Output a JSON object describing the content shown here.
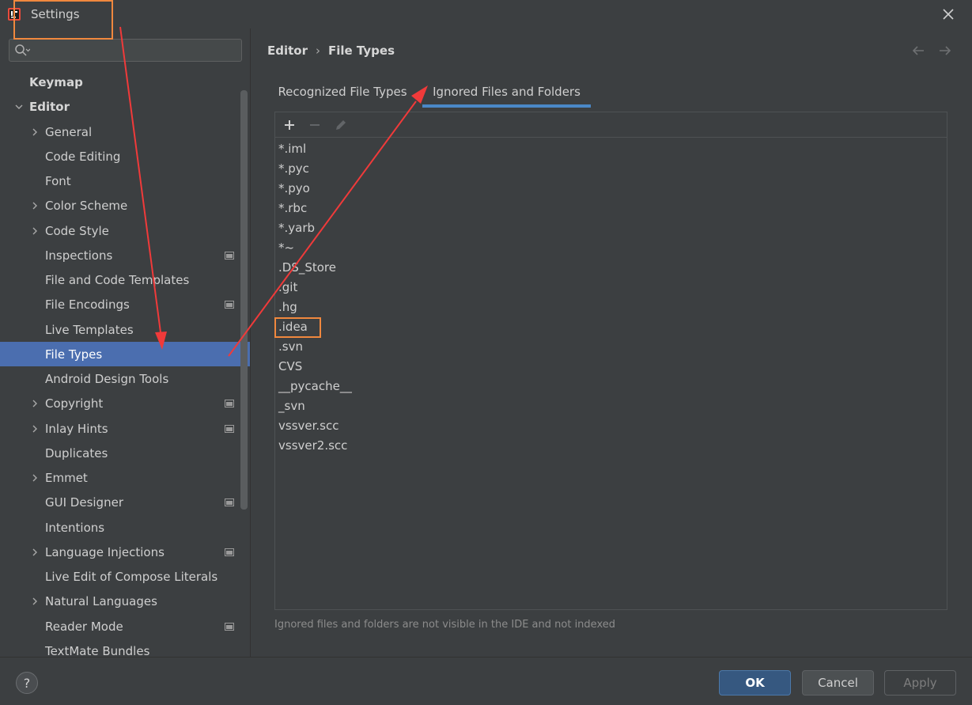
{
  "window": {
    "title": "Settings"
  },
  "search": {
    "placeholder": "",
    "value": ""
  },
  "sidebar": {
    "items": [
      {
        "label": "Keymap"
      },
      {
        "label": "Editor"
      },
      {
        "label": "General"
      },
      {
        "label": "Code Editing"
      },
      {
        "label": "Font"
      },
      {
        "label": "Color Scheme"
      },
      {
        "label": "Code Style"
      },
      {
        "label": "Inspections"
      },
      {
        "label": "File and Code Templates"
      },
      {
        "label": "File Encodings"
      },
      {
        "label": "Live Templates"
      },
      {
        "label": "File Types"
      },
      {
        "label": "Android Design Tools"
      },
      {
        "label": "Copyright"
      },
      {
        "label": "Inlay Hints"
      },
      {
        "label": "Duplicates"
      },
      {
        "label": "Emmet"
      },
      {
        "label": "GUI Designer"
      },
      {
        "label": "Intentions"
      },
      {
        "label": "Language Injections"
      },
      {
        "label": "Live Edit of Compose Literals"
      },
      {
        "label": "Natural Languages"
      },
      {
        "label": "Reader Mode"
      },
      {
        "label": "TextMate Bundles"
      }
    ],
    "selected": "File Types"
  },
  "breadcrumb": {
    "parent": "Editor",
    "separator": "›",
    "current": "File Types"
  },
  "tabs": [
    {
      "label": "Recognized File Types"
    },
    {
      "label": "Ignored Files and Folders"
    }
  ],
  "active_tab": "Ignored Files and Folders",
  "ignored_list": [
    "*.iml",
    "*.pyc",
    "*.pyo",
    "*.rbc",
    "*.yarb",
    "*~",
    ".DS_Store",
    ".git",
    ".hg",
    ".idea",
    ".svn",
    "CVS",
    "__pycache__",
    "_svn",
    "vssver.scc",
    "vssver2.scc"
  ],
  "highlighted_item": ".idea",
  "hint": "Ignored files and folders are not visible in the IDE and not indexed",
  "buttons": {
    "help": "?",
    "ok": "OK",
    "cancel": "Cancel",
    "apply": "Apply"
  },
  "colors": {
    "background": "#3c3f41",
    "selection": "#4b6eaf",
    "tab_underline": "#4a88c7",
    "annotation_box": "#f0883e",
    "annotation_arrow": "#f03a3a"
  }
}
